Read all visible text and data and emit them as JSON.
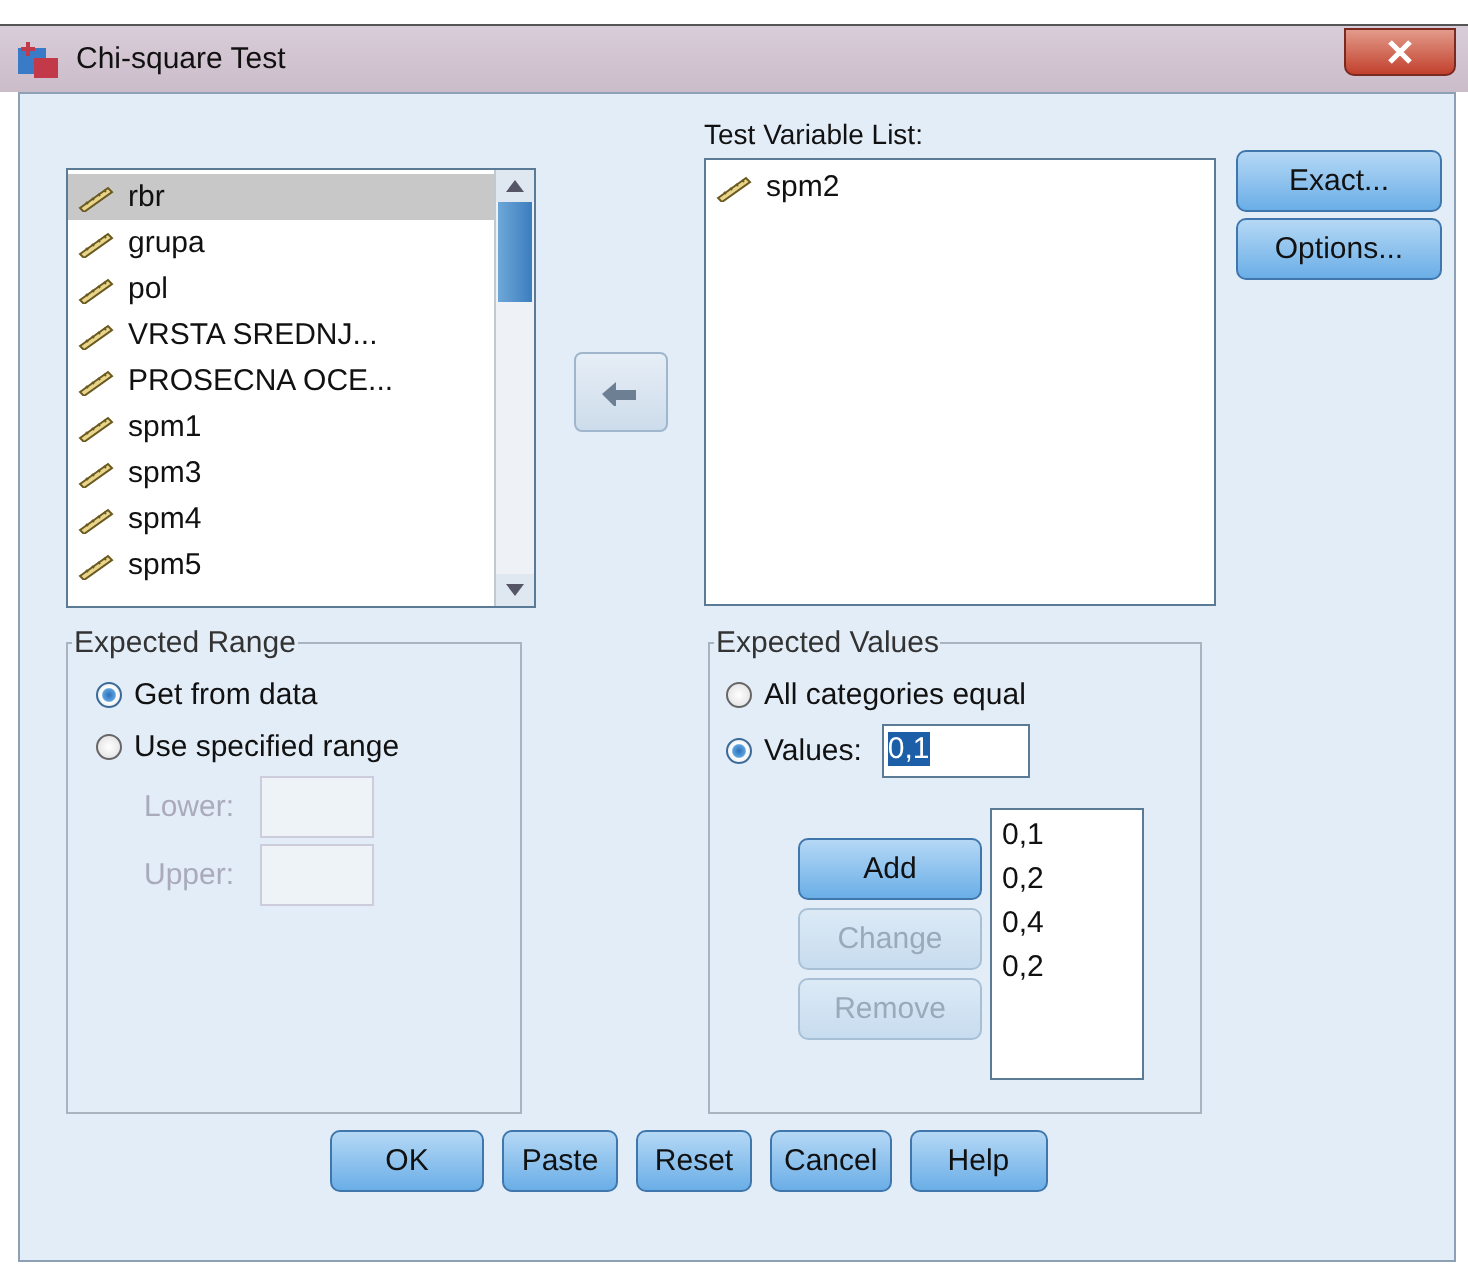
{
  "window": {
    "title": "Chi-square Test"
  },
  "source_list": {
    "items": [
      {
        "name": "rbr",
        "selected": true
      },
      {
        "name": "grupa",
        "selected": false
      },
      {
        "name": "pol",
        "selected": false
      },
      {
        "name": "VRSTA SREDNJ...",
        "selected": false
      },
      {
        "name": "PROSECNA OCE...",
        "selected": false
      },
      {
        "name": "spm1",
        "selected": false
      },
      {
        "name": "spm3",
        "selected": false
      },
      {
        "name": "spm4",
        "selected": false
      },
      {
        "name": "spm5",
        "selected": false
      }
    ]
  },
  "test_variable_list": {
    "label": "Test Variable List:",
    "items": [
      {
        "name": "spm2",
        "selected": false
      }
    ]
  },
  "side_buttons": [
    {
      "label": "Exact...",
      "disabled": false
    },
    {
      "label": "Options...",
      "disabled": false
    }
  ],
  "expected_range": {
    "title": "Expected Range",
    "options": [
      {
        "label": "Get from data",
        "selected": true
      },
      {
        "label": "Use specified range",
        "selected": false
      }
    ],
    "fields": [
      {
        "label": "Lower:",
        "disabled": true
      },
      {
        "label": "Upper:",
        "disabled": true
      }
    ]
  },
  "expected_values": {
    "title": "Expected Values",
    "options": [
      {
        "label": "All categories equal",
        "selected": false
      },
      {
        "label": "Values:",
        "selected": true
      }
    ],
    "value": "0,1",
    "buttons": [
      {
        "label": "Add",
        "disabled": false
      },
      {
        "label": "Change",
        "disabled": true
      },
      {
        "label": "Remove",
        "disabled": true
      }
    ],
    "list": [
      "0,1",
      "0,2",
      "0,4",
      "0,2"
    ]
  },
  "buttons": [
    {
      "label": "OK"
    },
    {
      "label": "Paste"
    },
    {
      "label": "Reset"
    },
    {
      "label": "Cancel"
    },
    {
      "label": "Help"
    }
  ]
}
